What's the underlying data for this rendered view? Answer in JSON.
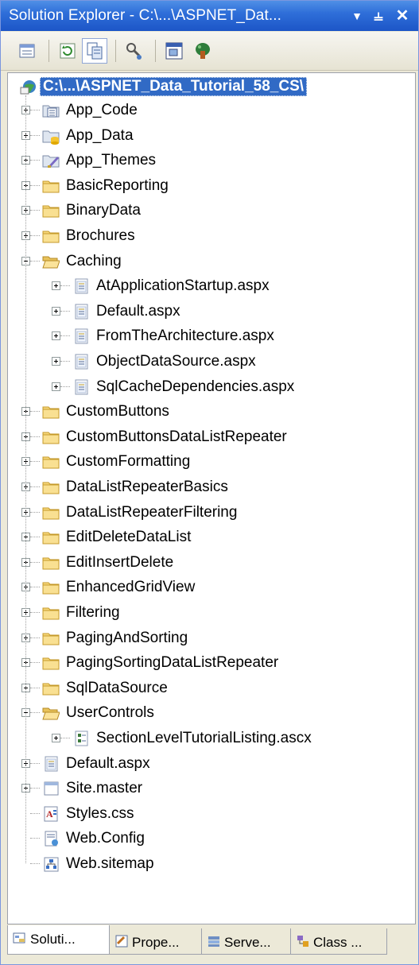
{
  "window": {
    "title": "Solution Explorer - C:\\...\\ASPNET_Dat...",
    "pin_glyph": "▼  ⫨",
    "close_glyph": "✕"
  },
  "toolbar": {
    "buttons": [
      "properties-icon",
      "refresh-icon",
      "show-all-files-icon",
      "view-code-icon",
      "view-designer-icon",
      "class-diagram-icon"
    ]
  },
  "tree": {
    "root": "C:\\...\\ASPNET_Data_Tutorial_58_CS\\",
    "items": [
      {
        "label": "App_Code",
        "icon": "special-folder-icon",
        "level": 1,
        "expander": "plus"
      },
      {
        "label": "App_Data",
        "icon": "data-folder-icon",
        "level": 1,
        "expander": "plus"
      },
      {
        "label": "App_Themes",
        "icon": "themes-folder-icon",
        "level": 1,
        "expander": "plus"
      },
      {
        "label": "BasicReporting",
        "icon": "folder-icon",
        "level": 1,
        "expander": "plus"
      },
      {
        "label": "BinaryData",
        "icon": "folder-icon",
        "level": 1,
        "expander": "plus"
      },
      {
        "label": "Brochures",
        "icon": "folder-icon",
        "level": 1,
        "expander": "plus"
      },
      {
        "label": "Caching",
        "icon": "open-folder-icon",
        "level": 1,
        "expander": "minus"
      },
      {
        "label": "AtApplicationStartup.aspx",
        "icon": "aspx-file-icon",
        "level": 2,
        "expander": "plus"
      },
      {
        "label": "Default.aspx",
        "icon": "aspx-file-icon",
        "level": 2,
        "expander": "plus"
      },
      {
        "label": "FromTheArchitecture.aspx",
        "icon": "aspx-file-icon",
        "level": 2,
        "expander": "plus"
      },
      {
        "label": "ObjectDataSource.aspx",
        "icon": "aspx-file-icon",
        "level": 2,
        "expander": "plus"
      },
      {
        "label": "SqlCacheDependencies.aspx",
        "icon": "aspx-file-icon",
        "level": 2,
        "expander": "plus"
      },
      {
        "label": "CustomButtons",
        "icon": "folder-icon",
        "level": 1,
        "expander": "plus"
      },
      {
        "label": "CustomButtonsDataListRepeater",
        "icon": "folder-icon",
        "level": 1,
        "expander": "plus"
      },
      {
        "label": "CustomFormatting",
        "icon": "folder-icon",
        "level": 1,
        "expander": "plus"
      },
      {
        "label": "DataListRepeaterBasics",
        "icon": "folder-icon",
        "level": 1,
        "expander": "plus"
      },
      {
        "label": "DataListRepeaterFiltering",
        "icon": "folder-icon",
        "level": 1,
        "expander": "plus"
      },
      {
        "label": "EditDeleteDataList",
        "icon": "folder-icon",
        "level": 1,
        "expander": "plus"
      },
      {
        "label": "EditInsertDelete",
        "icon": "folder-icon",
        "level": 1,
        "expander": "plus"
      },
      {
        "label": "EnhancedGridView",
        "icon": "folder-icon",
        "level": 1,
        "expander": "plus"
      },
      {
        "label": "Filtering",
        "icon": "folder-icon",
        "level": 1,
        "expander": "plus"
      },
      {
        "label": "PagingAndSorting",
        "icon": "folder-icon",
        "level": 1,
        "expander": "plus"
      },
      {
        "label": "PagingSortingDataListRepeater",
        "icon": "folder-icon",
        "level": 1,
        "expander": "plus"
      },
      {
        "label": "SqlDataSource",
        "icon": "folder-icon",
        "level": 1,
        "expander": "plus"
      },
      {
        "label": "UserControls",
        "icon": "open-folder-icon",
        "level": 1,
        "expander": "minus"
      },
      {
        "label": "SectionLevelTutorialListing.ascx",
        "icon": "ascx-file-icon",
        "level": 2,
        "expander": "plus"
      },
      {
        "label": "Default.aspx",
        "icon": "aspx-file-icon",
        "level": 1,
        "expander": "plus"
      },
      {
        "label": "Site.master",
        "icon": "master-file-icon",
        "level": 1,
        "expander": "plus"
      },
      {
        "label": "Styles.css",
        "icon": "css-file-icon",
        "level": 1,
        "expander": "none"
      },
      {
        "label": "Web.Config",
        "icon": "config-file-icon",
        "level": 1,
        "expander": "none"
      },
      {
        "label": "Web.sitemap",
        "icon": "sitemap-file-icon",
        "level": 1,
        "expander": "none"
      }
    ]
  },
  "tabs": [
    {
      "label": "Soluti...",
      "icon": "solution-explorer-icon",
      "active": true
    },
    {
      "label": "Prope...",
      "icon": "properties-icon",
      "active": false
    },
    {
      "label": "Serve...",
      "icon": "server-explorer-icon",
      "active": false
    },
    {
      "label": "Class ...",
      "icon": "class-view-icon",
      "active": false
    }
  ]
}
